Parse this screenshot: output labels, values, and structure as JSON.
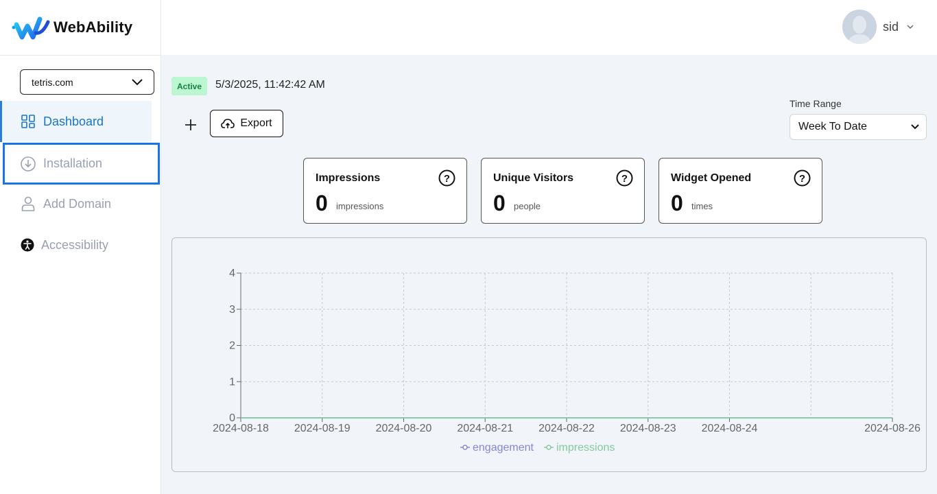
{
  "brand": {
    "name": "WebAbility"
  },
  "sidebar": {
    "domain_select": "tetris.com",
    "items": [
      {
        "label": "Dashboard",
        "icon": "dashboard-icon"
      },
      {
        "label": "Installation",
        "icon": "download-circle-icon"
      },
      {
        "label": "Add Domain",
        "icon": "user-icon"
      },
      {
        "label": "Accessibility",
        "icon": "accessibility-icon"
      }
    ]
  },
  "header": {
    "user_name": "sid"
  },
  "status": {
    "badge": "Active",
    "timestamp": "5/3/2025, 11:42:42 AM"
  },
  "toolbar": {
    "export_label": "Export"
  },
  "time_range": {
    "label": "Time Range",
    "selected": "Week To Date"
  },
  "cards": [
    {
      "title": "Impressions",
      "value": "0",
      "unit": "impressions"
    },
    {
      "title": "Unique Visitors",
      "value": "0",
      "unit": "people"
    },
    {
      "title": "Widget Opened",
      "value": "0",
      "unit": "times"
    }
  ],
  "colors": {
    "accent": "#1a73c7",
    "engagement": "#8884d8",
    "impressions": "#82ca9d",
    "active_badge_bg": "#bbf7d0"
  },
  "chart_data": {
    "type": "line",
    "x": [
      "2024-08-18",
      "2024-08-19",
      "2024-08-20",
      "2024-08-21",
      "2024-08-22",
      "2024-08-23",
      "2024-08-24",
      "2024-08-26"
    ],
    "x_dates_for_scale": [
      "2024-08-18",
      "2024-08-19",
      "2024-08-20",
      "2024-08-21",
      "2024-08-22",
      "2024-08-23",
      "2024-08-24",
      "2024-08-26"
    ],
    "series": [
      {
        "name": "engagement",
        "values": [
          0,
          0,
          0,
          0,
          0,
          0,
          0,
          0
        ]
      },
      {
        "name": "impressions",
        "values": [
          0,
          0,
          0,
          0,
          0,
          0,
          0,
          0
        ]
      }
    ],
    "yticks": [
      "0",
      "1",
      "2",
      "3",
      "4"
    ],
    "ylim": [
      0,
      4
    ],
    "grid": true,
    "legend": "bottom"
  }
}
